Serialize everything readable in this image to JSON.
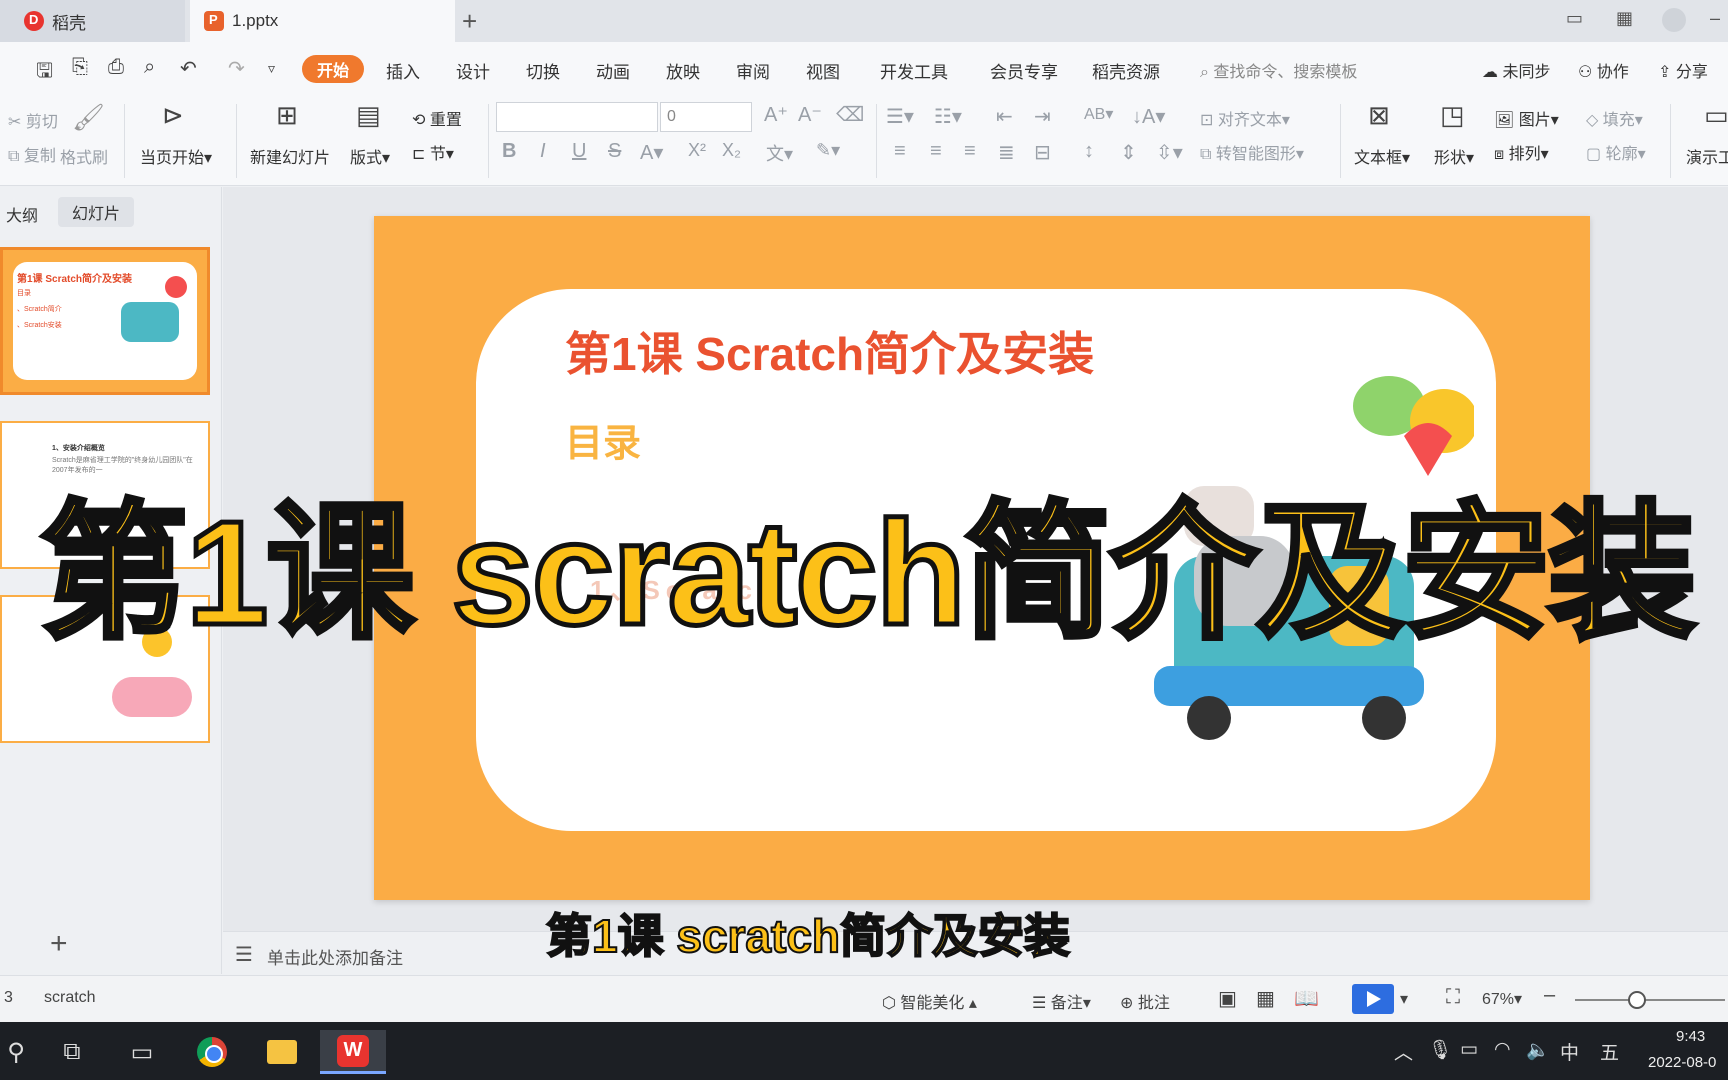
{
  "tabs": [
    {
      "label": "稻壳"
    },
    {
      "label": "1.pptx"
    }
  ],
  "menu": {
    "start": "开始",
    "items": [
      "插入",
      "设计",
      "切换",
      "动画",
      "放映",
      "审阅",
      "视图",
      "开发工具",
      "会员专享",
      "稻壳资源"
    ],
    "search_placeholder": "查找命令、搜索模板",
    "sync": "未同步",
    "collab": "协作",
    "share": "分享"
  },
  "ribbon": {
    "cut": "剪切",
    "copy": "复制",
    "format_painter": "格式刷",
    "from_current": "当页开始",
    "new_slide": "新建幻灯片",
    "layout": "版式",
    "reset": "重置",
    "section": "节",
    "font_size_value": "0",
    "align_text": "对齐文本",
    "smart_shape": "转智能图形",
    "textbox": "文本框",
    "shape": "形状",
    "picture": "图片",
    "fill": "填充",
    "arrange": "排列",
    "outline": "轮廓",
    "demo": "演示工"
  },
  "leftpanel": {
    "outline_tab": "大纲",
    "slides_tab": "幻灯片",
    "thumb1": {
      "title": "第1课 Scratch简介及安装",
      "line1": "目录",
      "line2": "、Scratch简介",
      "line3": "、Scratch安装"
    },
    "thumb2": {
      "title": "1、安装介绍概览",
      "body": "Scratch是麻省理工学院的\"终身幼儿园团队\"在2007年发布的一"
    }
  },
  "slide": {
    "title": "第1课 Scratch简介及安装",
    "toc": "目录",
    "fragment": "1、Scratch"
  },
  "notes_placeholder": "单击此处添加备注",
  "captions": {
    "big": "第1课 scratch简介及安装",
    "sub": "第1课 scratch简介及安装"
  },
  "statusbar": {
    "slide_num": "3",
    "theme": "scratch",
    "beautify": "智能美化",
    "notes": "备注",
    "comments": "批注",
    "zoom": "67%"
  },
  "taskbar": {
    "ime_lang": "中",
    "ime_mode": "五",
    "time": "9:43",
    "date": "2022-08-0"
  }
}
